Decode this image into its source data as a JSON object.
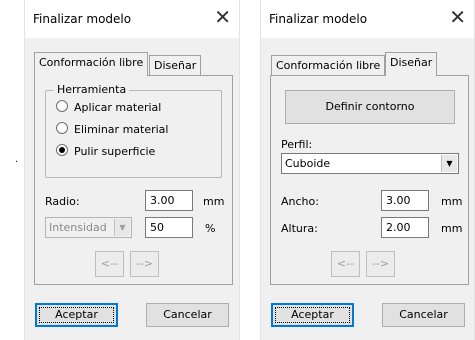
{
  "dialog_left": {
    "title": "Finalizar modelo",
    "tabs": [
      "Conformación libre",
      "Diseñar"
    ],
    "group_label": "Herramienta",
    "radios": [
      "Aplicar material",
      "Eliminar material",
      "Pulir superficie"
    ],
    "selected_radio": "Pulir superficie",
    "radius_label": "Radio:",
    "radius_value": "3.00",
    "radius_unit": "mm",
    "intensity_select": "Intensidad",
    "intensity_value": "50",
    "intensity_unit": "%",
    "prev_button": "<--",
    "next_button": "-->",
    "accept_button": "Aceptar",
    "cancel_button": "Cancelar"
  },
  "dialog_right": {
    "title": "Finalizar modelo",
    "tabs": [
      "Conformación libre",
      "Diseñar"
    ],
    "define_button": "Definir contorno",
    "profile_label": "Perfil:",
    "profile_value": "Cuboide",
    "width_label": "Ancho:",
    "width_value": "3.00",
    "width_unit": "mm",
    "height_label": "Altura:",
    "height_value": "2.00",
    "height_unit": "mm",
    "prev_button": "<--",
    "next_button": "-->",
    "accept_button": "Aceptar",
    "cancel_button": "Cancelar"
  },
  "marker": "."
}
